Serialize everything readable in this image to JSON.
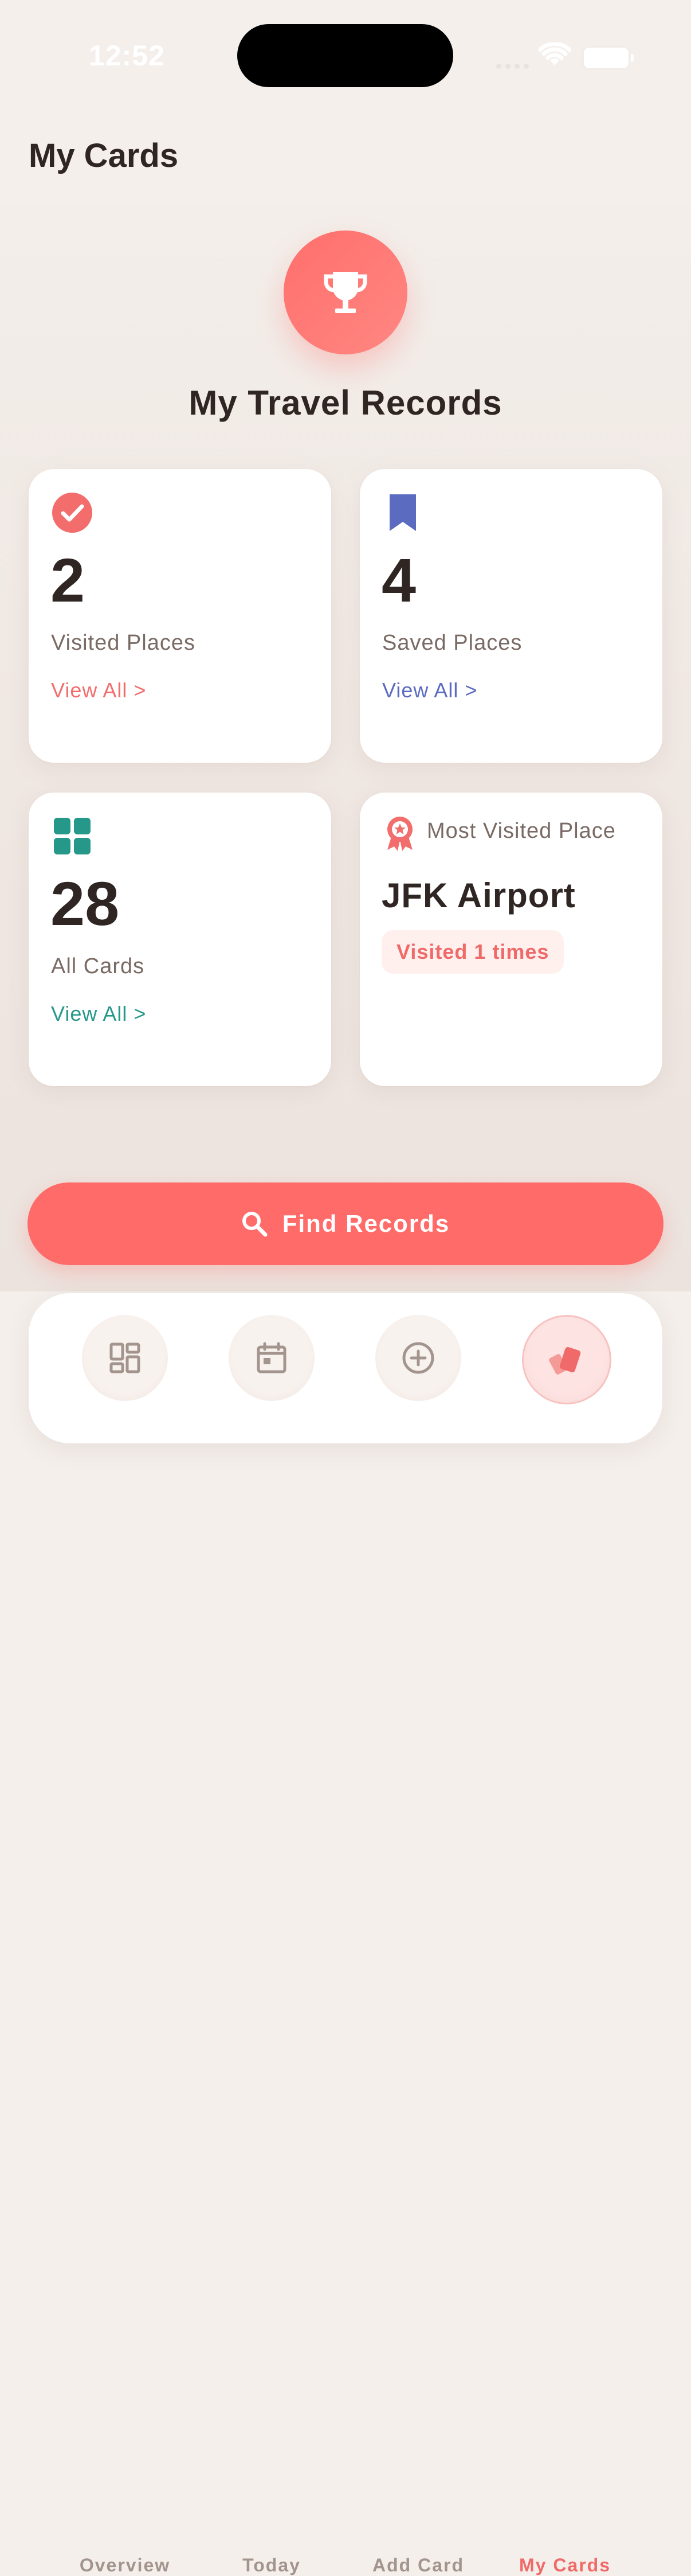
{
  "status_bar": {
    "time": "12:52"
  },
  "header": {
    "title": "My Cards"
  },
  "hero": {
    "title": "My Travel Records",
    "icon": "trophy-icon"
  },
  "cards": {
    "visited": {
      "count": "2",
      "label": "Visited Places",
      "link": "View All >",
      "color": "#f26d6b"
    },
    "saved": {
      "count": "4",
      "label": "Saved Places",
      "link": "View All >",
      "color": "#5b6bc0"
    },
    "all": {
      "count": "28",
      "label": "All Cards",
      "link": "View All >",
      "color": "#26988a"
    },
    "most_visited": {
      "heading": "Most Visited Place",
      "place": "JFK Airport",
      "badge": "Visited 1 times"
    }
  },
  "actions": {
    "find_label": "Find Records"
  },
  "tabbar": {
    "items": [
      {
        "label": "Overview",
        "icon": "overview-icon"
      },
      {
        "label": "Today",
        "icon": "calendar-icon"
      },
      {
        "label": "Add Card",
        "icon": "add-circle-icon"
      },
      {
        "label": "My Cards",
        "icon": "cards-icon",
        "active": true
      }
    ],
    "active_color": "#ef6a68"
  }
}
